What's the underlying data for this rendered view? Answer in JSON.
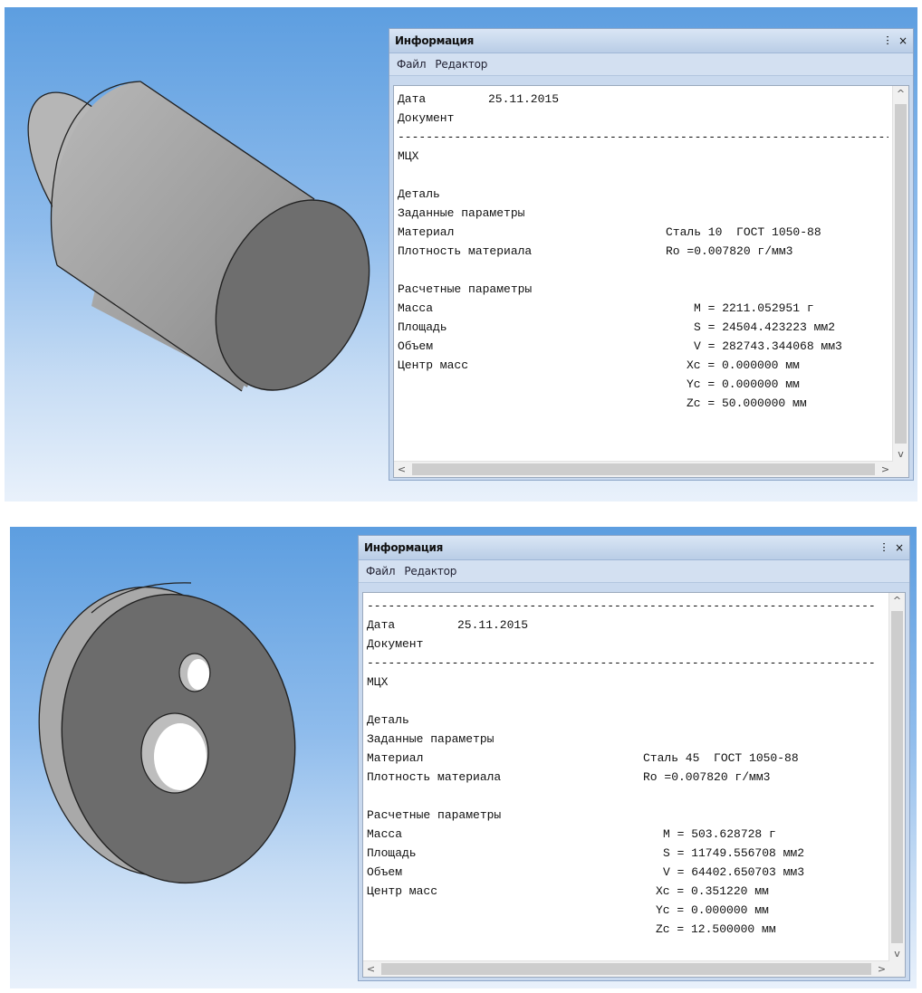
{
  "panels": [
    {
      "title": "Информация",
      "pin_glyph": "ⵗ",
      "close_glyph": "×",
      "menu": [
        "Файл",
        "Редактор"
      ],
      "header_dashes": false,
      "date_label": "Дата",
      "date_value": "25.11.2015",
      "document_label": "Документ",
      "separator": "------------------------------------------------------------------------",
      "doc_name": "МЦХ",
      "part_label": "Деталь",
      "given_params_label": "Заданные параметры",
      "material_label": "Материал",
      "material_value": "Сталь 10  ГОСТ 1050-88",
      "density_label": "Плотность материала",
      "density_value": "Ro =0.007820 г/мм3",
      "calc_params_label": "Расчетные параметры",
      "mass_label": "Масса",
      "mass_value": "M = 2211.052951 г",
      "area_label": "Площадь",
      "area_value": "S = 24504.423223 мм2",
      "volume_label": "Объем",
      "volume_value": "V = 282743.344068 мм3",
      "center_label": "Центр масс",
      "xc_value": "Xc = 0.000000 мм",
      "yc_value": "Yc = 0.000000 мм",
      "zc_value": "Zc = 50.000000 мм",
      "scroll_up": "^",
      "scroll_down": "v",
      "scroll_left": "<",
      "scroll_right": ">"
    },
    {
      "title": "Информация",
      "pin_glyph": "ⵗ",
      "close_glyph": "×",
      "menu": [
        "Файл",
        "Редактор"
      ],
      "header_dashes": true,
      "date_label": "Дата",
      "date_value": "25.11.2015",
      "document_label": "Документ",
      "separator": "------------------------------------------------------------------------",
      "doc_name": "МЦХ",
      "part_label": "Деталь",
      "given_params_label": "Заданные параметры",
      "material_label": "Материал",
      "material_value": "Сталь 45  ГОСТ 1050-88",
      "density_label": "Плотность материала",
      "density_value": "Ro =0.007820 г/мм3",
      "calc_params_label": "Расчетные параметры",
      "mass_label": "Масса",
      "mass_value": "M = 503.628728 г",
      "area_label": "Площадь",
      "area_value": "S = 11749.556708 мм2",
      "volume_label": "Объем",
      "volume_value": "V = 64402.650703 мм3",
      "center_label": "Центр масс",
      "xc_value": "Xc = 0.351220 мм",
      "yc_value": "Yc = 0.000000 мм",
      "zc_value": "Zc = 12.500000 мм",
      "scroll_up": "^",
      "scroll_down": "v",
      "scroll_left": "<",
      "scroll_right": ">"
    }
  ],
  "colors": {
    "background_top": "#5d9ee0",
    "background_bottom": "#e9f1fb",
    "model_fill": "#9a9a9a",
    "model_face": "#6b6b6b"
  },
  "icons": [
    "cylinder-model",
    "disc-model",
    "pin-icon",
    "close-icon"
  ]
}
